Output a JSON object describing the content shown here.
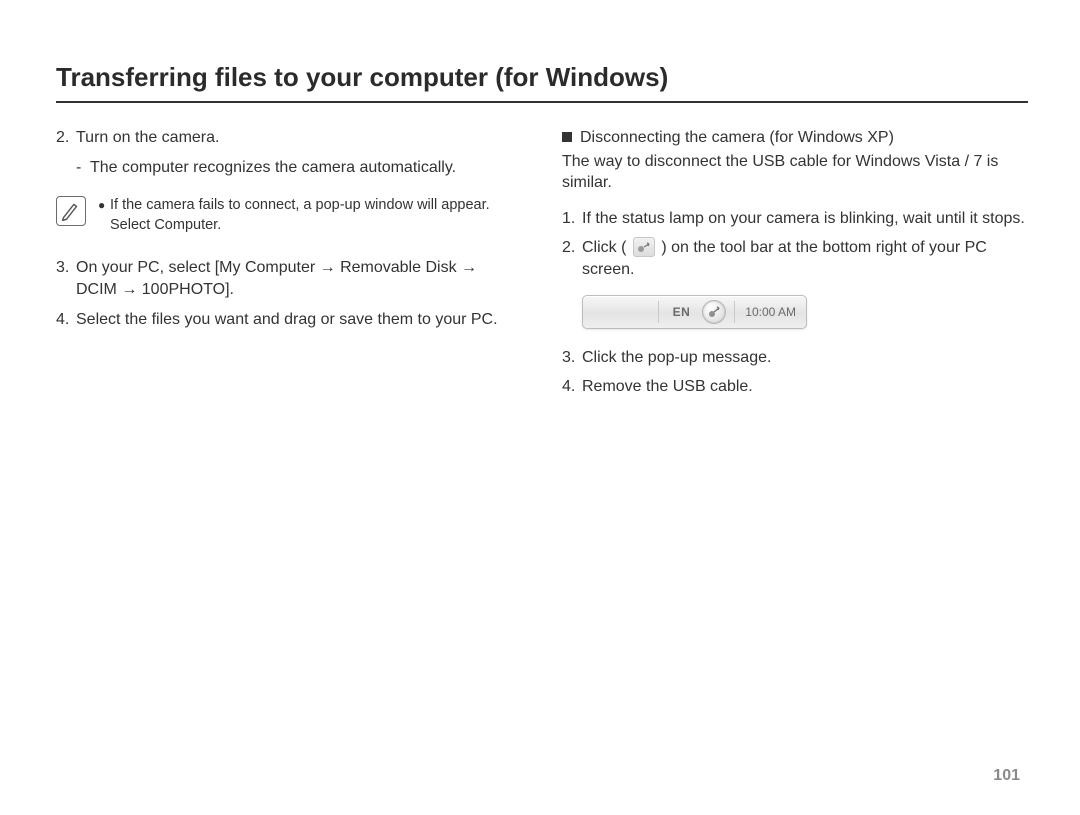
{
  "title": "Transferring files to your computer (for Windows)",
  "pageNumber": "101",
  "left": {
    "step2": {
      "num": "2.",
      "text": "Turn on the camera."
    },
    "step2sub": {
      "dash": "-",
      "text": "The computer recognizes the camera automatically."
    },
    "note": {
      "line1": "If the camera fails to connect, a pop-up window will appear.",
      "line2": "Select Computer."
    },
    "step3": {
      "num": "3.",
      "text": "On your PC, select [My Computer → Removable Disk → DCIM → 100PHOTO]."
    },
    "step4": {
      "num": "4.",
      "text": "Select the files you want and drag or save them to your PC."
    }
  },
  "right": {
    "header": "Disconnecting the camera (for Windows XP)",
    "headerSub": "The way to disconnect the USB cable for Windows Vista / 7 is similar.",
    "d1": {
      "num": "1.",
      "text": "If the status lamp on your camera is blinking, wait until it stops."
    },
    "d2": {
      "num": "2.",
      "pre": "Click (",
      "post": ") on the tool bar at the bottom right of your PC screen."
    },
    "taskbar": {
      "lang": "EN",
      "time": "10:00 AM"
    },
    "d3": {
      "num": "3.",
      "text": "Click the pop-up message."
    },
    "d4": {
      "num": "4.",
      "text": "Remove the USB cable."
    }
  }
}
